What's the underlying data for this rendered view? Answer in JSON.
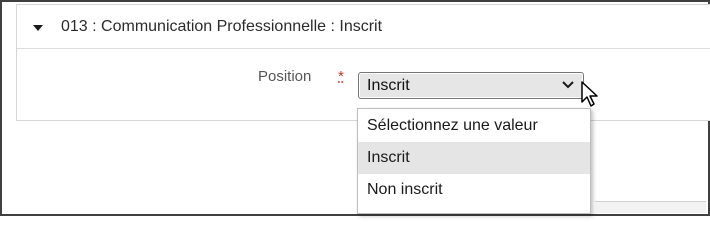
{
  "section": {
    "title": "013 : Communication Professionnelle : Inscrit"
  },
  "form": {
    "position_label": "Position",
    "required_marker": "*",
    "position_selected": "Inscrit",
    "position_options": [
      "Sélectionnez une valeur",
      "Inscrit",
      "Non inscrit"
    ],
    "highlighted_option_index": 1
  },
  "icons": {
    "caret": "caret-down-icon",
    "chevron": "chevron-down-icon",
    "cursor": "mouse-pointer-icon"
  },
  "colors": {
    "required": "#c0392b",
    "highlight": "#e5e5e5",
    "select_bg": "#e6e6e6"
  }
}
